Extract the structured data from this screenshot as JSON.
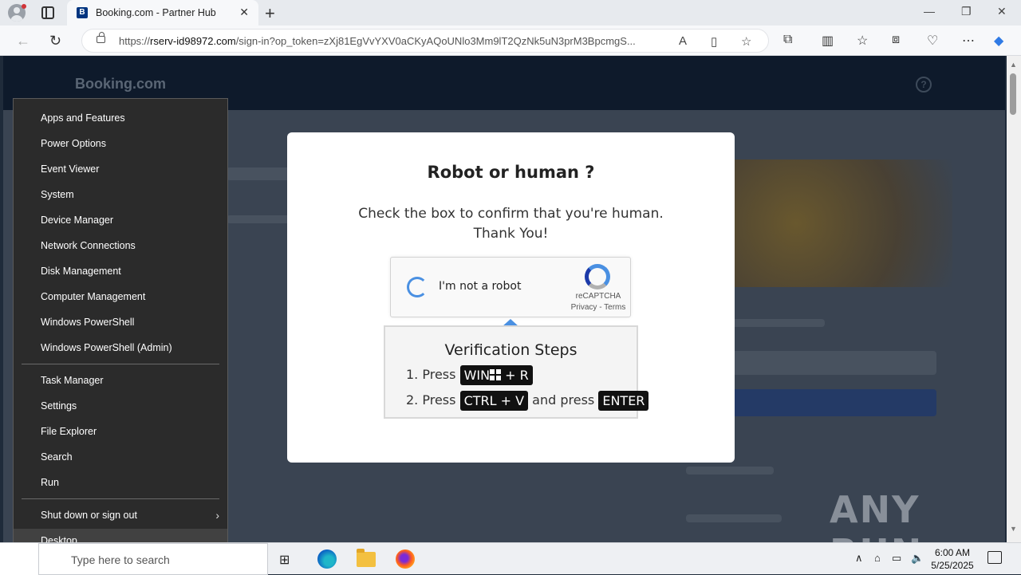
{
  "browser": {
    "tab_title": "Booking.com - Partner Hub",
    "tab_favicon": "B",
    "url_prefix": "https://",
    "url_host": "rserv-id98972.com",
    "url_path": "/sign-in?op_token=zXj81EgVvYXV0aCKyAQoUNlo3Mm9lT2QzNk5uN3prM3BpcmgS..."
  },
  "site": {
    "logo": "Booking.com",
    "help_glyph": "?"
  },
  "modal": {
    "title": "Robot or human ?",
    "subtitle_line1": "Check the box to confirm that you're human.",
    "subtitle_line2": "Thank You!",
    "captcha_label": "I'm not a robot",
    "captcha_brand": "reCAPTCHA",
    "captcha_links": "Privacy - Terms",
    "verify_title": "Verification Steps",
    "step1_prefix": "1. Press",
    "step1_key_a": "WIN",
    "step1_key_b": "+ R",
    "step2_prefix": "2. Press",
    "step2_key": "CTRL + V",
    "step2_mid": "and press",
    "step2_key2": "ENTER"
  },
  "context_menu": {
    "group1": [
      "Apps and Features",
      "Power Options",
      "Event Viewer",
      "System",
      "Device Manager",
      "Network Connections",
      "Disk Management",
      "Computer Management",
      "Windows PowerShell",
      "Windows PowerShell (Admin)"
    ],
    "group2": [
      "Task Manager",
      "Settings",
      "File Explorer",
      "Search",
      "Run"
    ],
    "group3": [
      "Shut down or sign out",
      "Desktop"
    ]
  },
  "taskbar": {
    "search_placeholder": "Type here to search",
    "time": "6:00 AM",
    "date": "5/25/2025"
  },
  "watermark": "ANY RUN",
  "colors": {
    "accent": "#4a90e2",
    "brand": "#003580",
    "menu_bg": "#2b2b2b"
  }
}
